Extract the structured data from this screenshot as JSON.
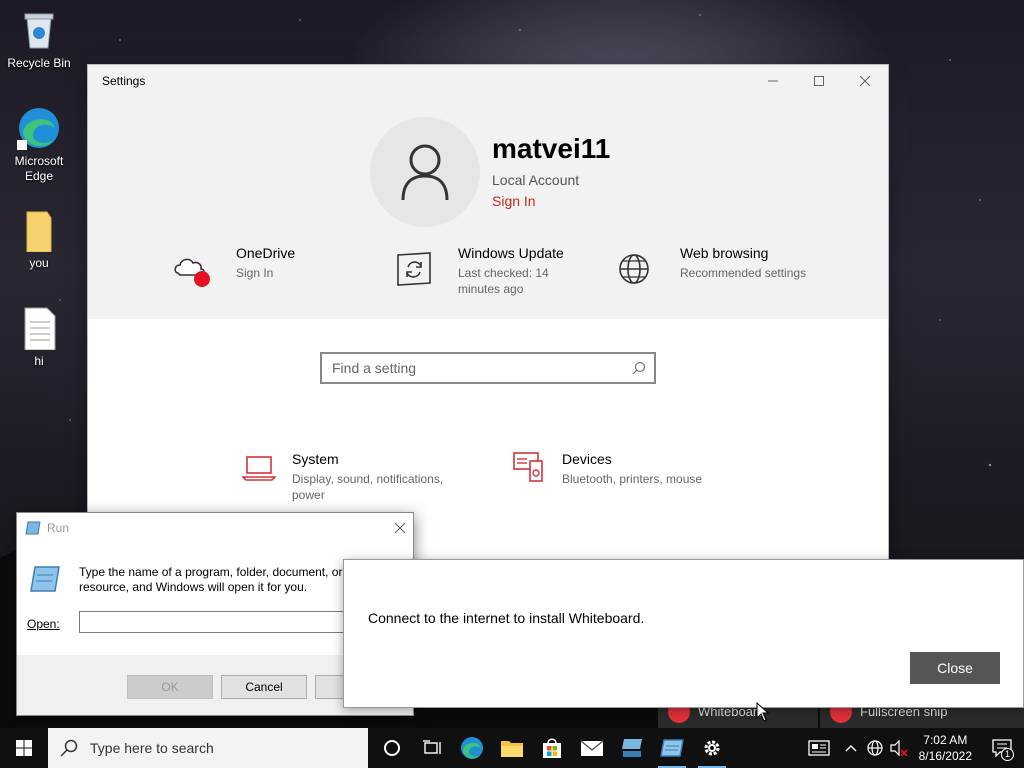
{
  "desktop": {
    "icons": [
      {
        "label": "Recycle Bin"
      },
      {
        "label": "Microsoft Edge"
      },
      {
        "label": "you"
      },
      {
        "label": "hi"
      }
    ]
  },
  "settings": {
    "title": "Settings",
    "user": {
      "name": "matvei11",
      "type": "Local Account",
      "sign_in": "Sign In"
    },
    "tiles": [
      {
        "name": "OneDrive",
        "sub": "Sign In"
      },
      {
        "name": "Windows Update",
        "sub": "Last checked: 14 minutes ago"
      },
      {
        "name": "Web browsing",
        "sub": "Recommended settings"
      }
    ],
    "search": {
      "placeholder": "Find a setting"
    },
    "categories": [
      {
        "name": "System",
        "sub": "Display, sound, notifications, power"
      },
      {
        "name": "Devices",
        "sub": "Bluetooth, printers, mouse"
      }
    ]
  },
  "run": {
    "title": "Run",
    "description": "Type the name of a program, folder, document, or resource, and Windows will open it for you.",
    "open_label": "Open:",
    "open_value": "",
    "ok": "OK",
    "cancel": "Cancel",
    "browse": "Br"
  },
  "toast": {
    "message": "Connect to the internet to install Whiteboard.",
    "close": "Close"
  },
  "flyouts": [
    {
      "label": "Whiteboard"
    },
    {
      "label": "Fullscreen snip"
    }
  ],
  "taskbar": {
    "search_placeholder": "Type here to search",
    "time": "7:02 AM",
    "date": "8/16/2022",
    "notification_count": "1"
  },
  "colors": {
    "accent_red": "#c42b1c",
    "taskbar": "#101010",
    "settings_header": "#f2f2f2"
  }
}
